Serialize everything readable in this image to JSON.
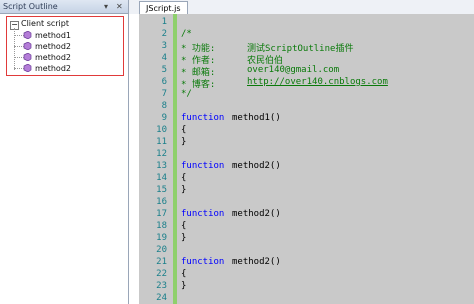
{
  "outline": {
    "title": "Script Outline",
    "pin": "▾",
    "close": "✕",
    "root": "Client script",
    "items": [
      "method1",
      "method2",
      "method2",
      "method2"
    ]
  },
  "editor": {
    "tab": "JScript.js",
    "line_numbers": [
      "1",
      "2",
      "3",
      "4",
      "5",
      "6",
      "7",
      "8",
      "9",
      "10",
      "11",
      "12",
      "13",
      "14",
      "15",
      "16",
      "17",
      "18",
      "19",
      "20",
      "21",
      "22",
      "23",
      "24"
    ],
    "comment_open": "/*",
    "comment_close": "*/",
    "header": [
      {
        "label": "* 功能:",
        "value": "测试ScriptOutline插件"
      },
      {
        "label": "* 作者:",
        "value": "农民伯伯"
      },
      {
        "label": "* 邮箱:",
        "value": "over140@gmail.com"
      },
      {
        "label": "* 博客:",
        "value": "http://over140.cnblogs.com"
      }
    ],
    "functions": [
      {
        "keyword": "function",
        "name": "method1()",
        "open": "{",
        "close": "}"
      },
      {
        "keyword": "function",
        "name": "method2()",
        "open": "{",
        "close": "}"
      },
      {
        "keyword": "function",
        "name": "method2()",
        "open": "{",
        "close": "}"
      },
      {
        "keyword": "function",
        "name": "method2()",
        "open": "{",
        "close": "}"
      }
    ]
  }
}
